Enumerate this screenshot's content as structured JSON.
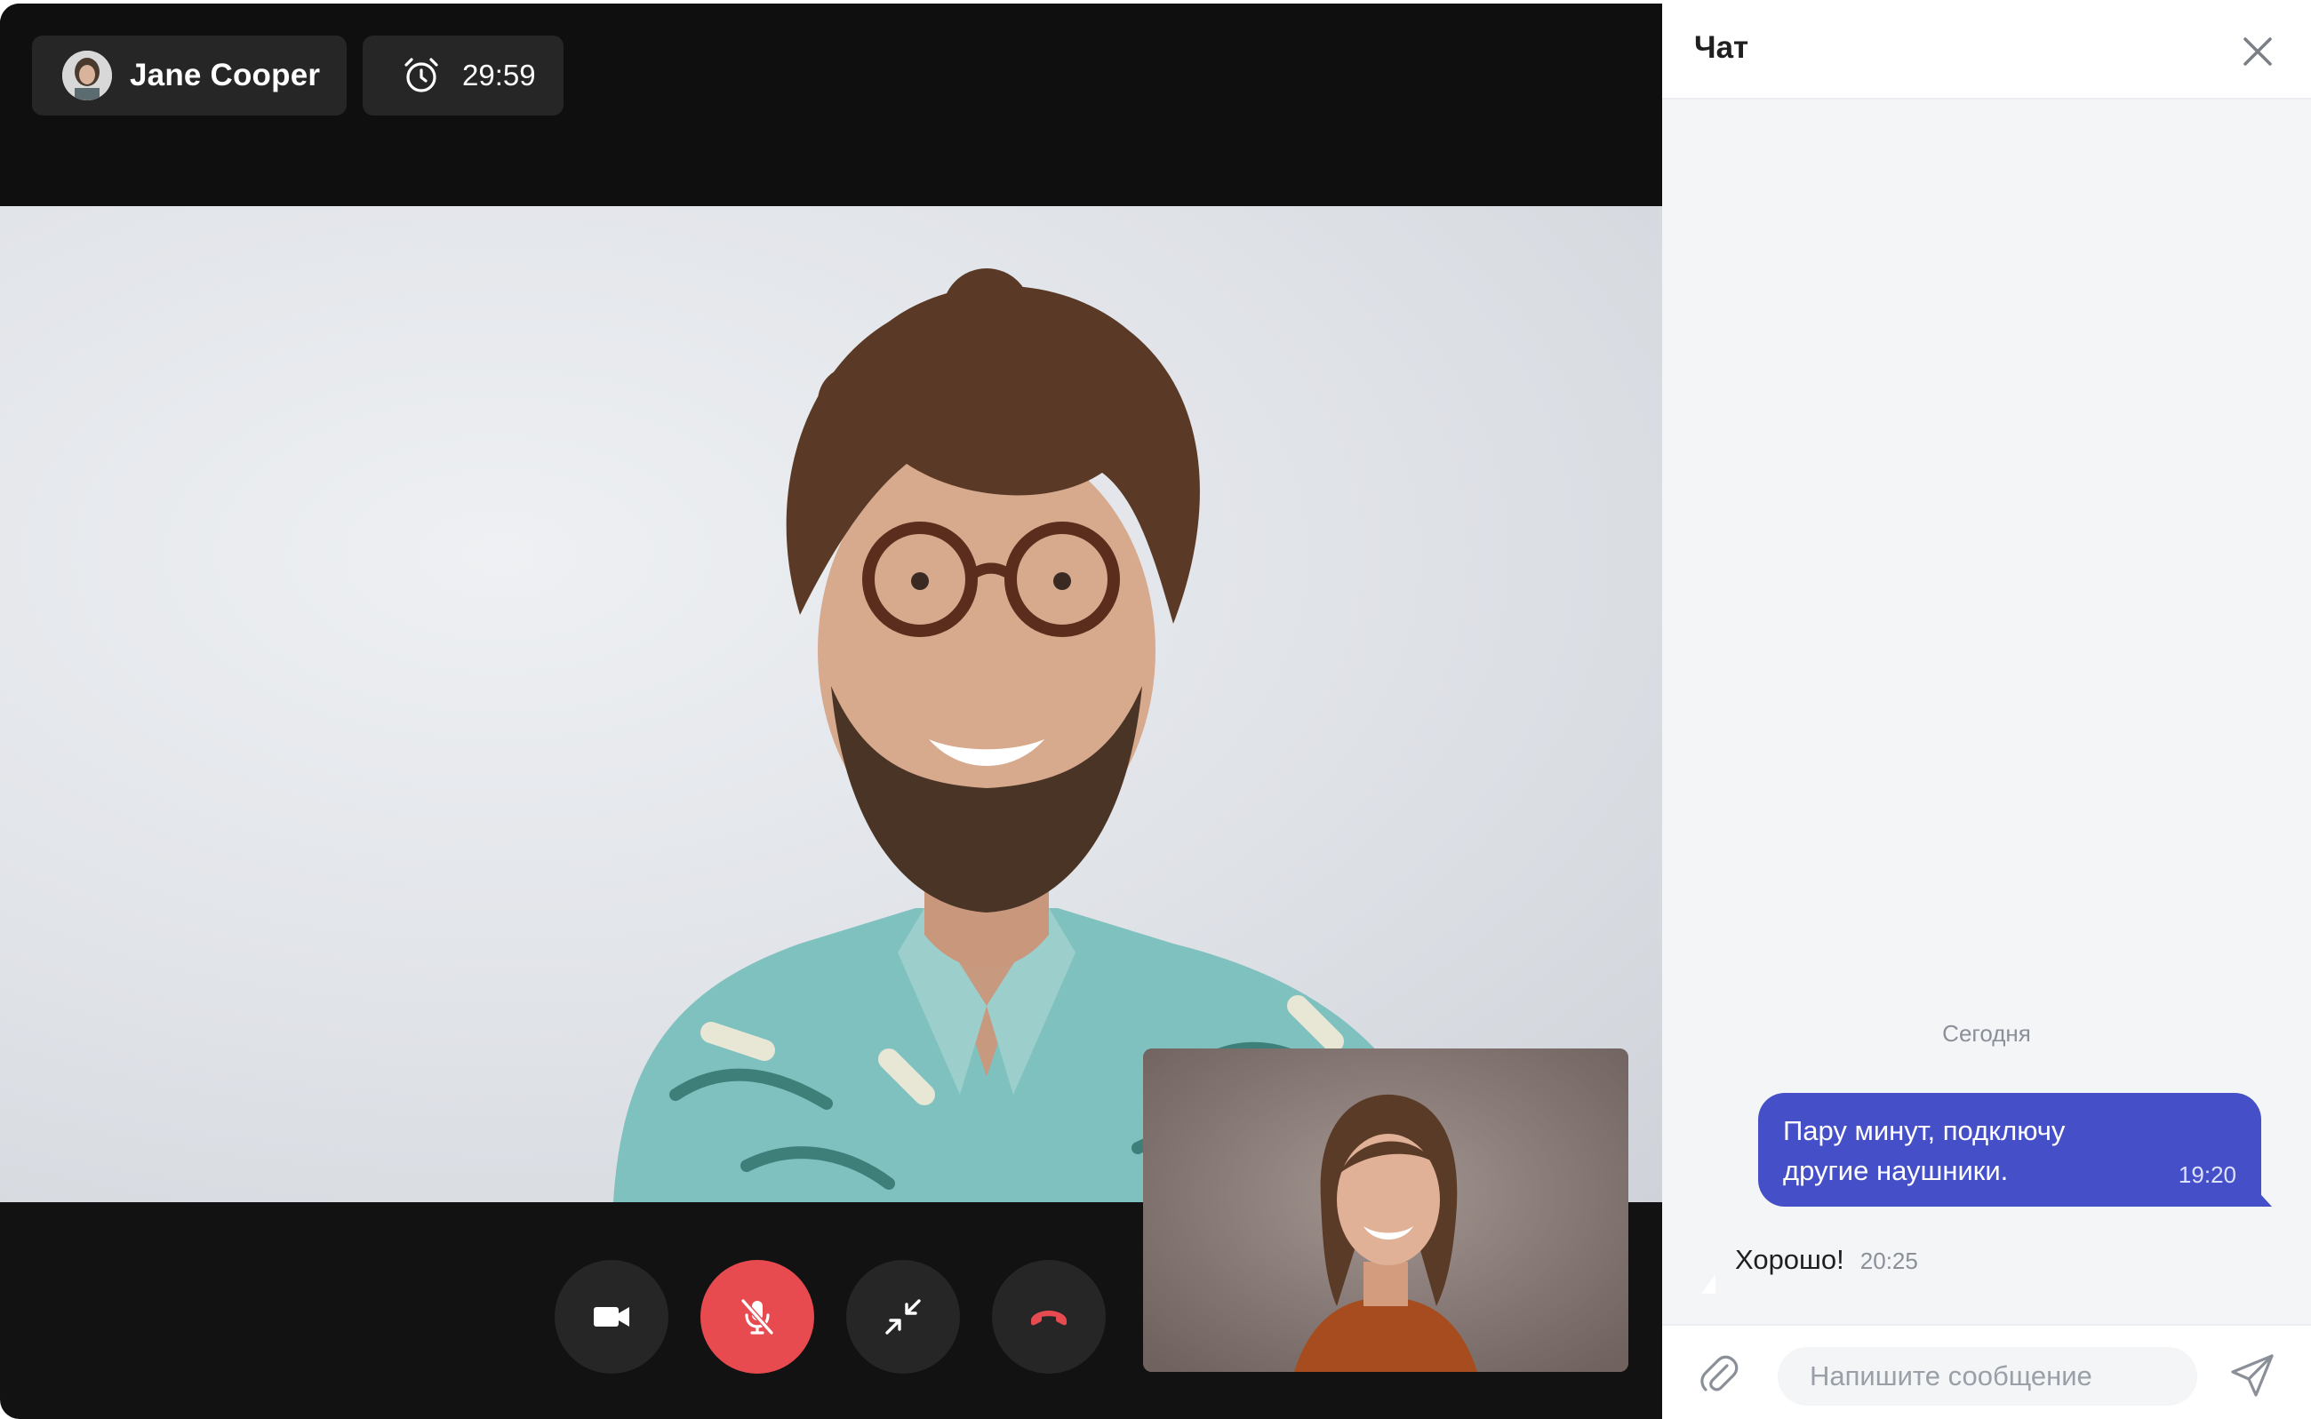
{
  "call": {
    "caller_name": "Jane Cooper",
    "timer": "29:59"
  },
  "controls": [
    {
      "name": "camera",
      "icon": "video-camera-icon"
    },
    {
      "name": "microphone",
      "icon": "microphone-off-icon",
      "active_color": "#e84b4f"
    },
    {
      "name": "minimize",
      "icon": "minimize-icon"
    },
    {
      "name": "hang-up",
      "icon": "phone-hangup-icon",
      "color": "#e84b4f"
    }
  ],
  "chat": {
    "title": "Чат",
    "date_divider": "Сегодня",
    "messages": [
      {
        "direction": "outgoing",
        "text": "Пару минут, подключу другие наушники.",
        "time": "19:20"
      },
      {
        "direction": "incoming",
        "text": "Хорошо!",
        "time": "20:25"
      }
    ],
    "input_placeholder": "Напишите сообщение"
  },
  "colors": {
    "accent": "#4550c8",
    "danger": "#e84b4f",
    "video_background": "#121212",
    "control_background": "#262626"
  }
}
